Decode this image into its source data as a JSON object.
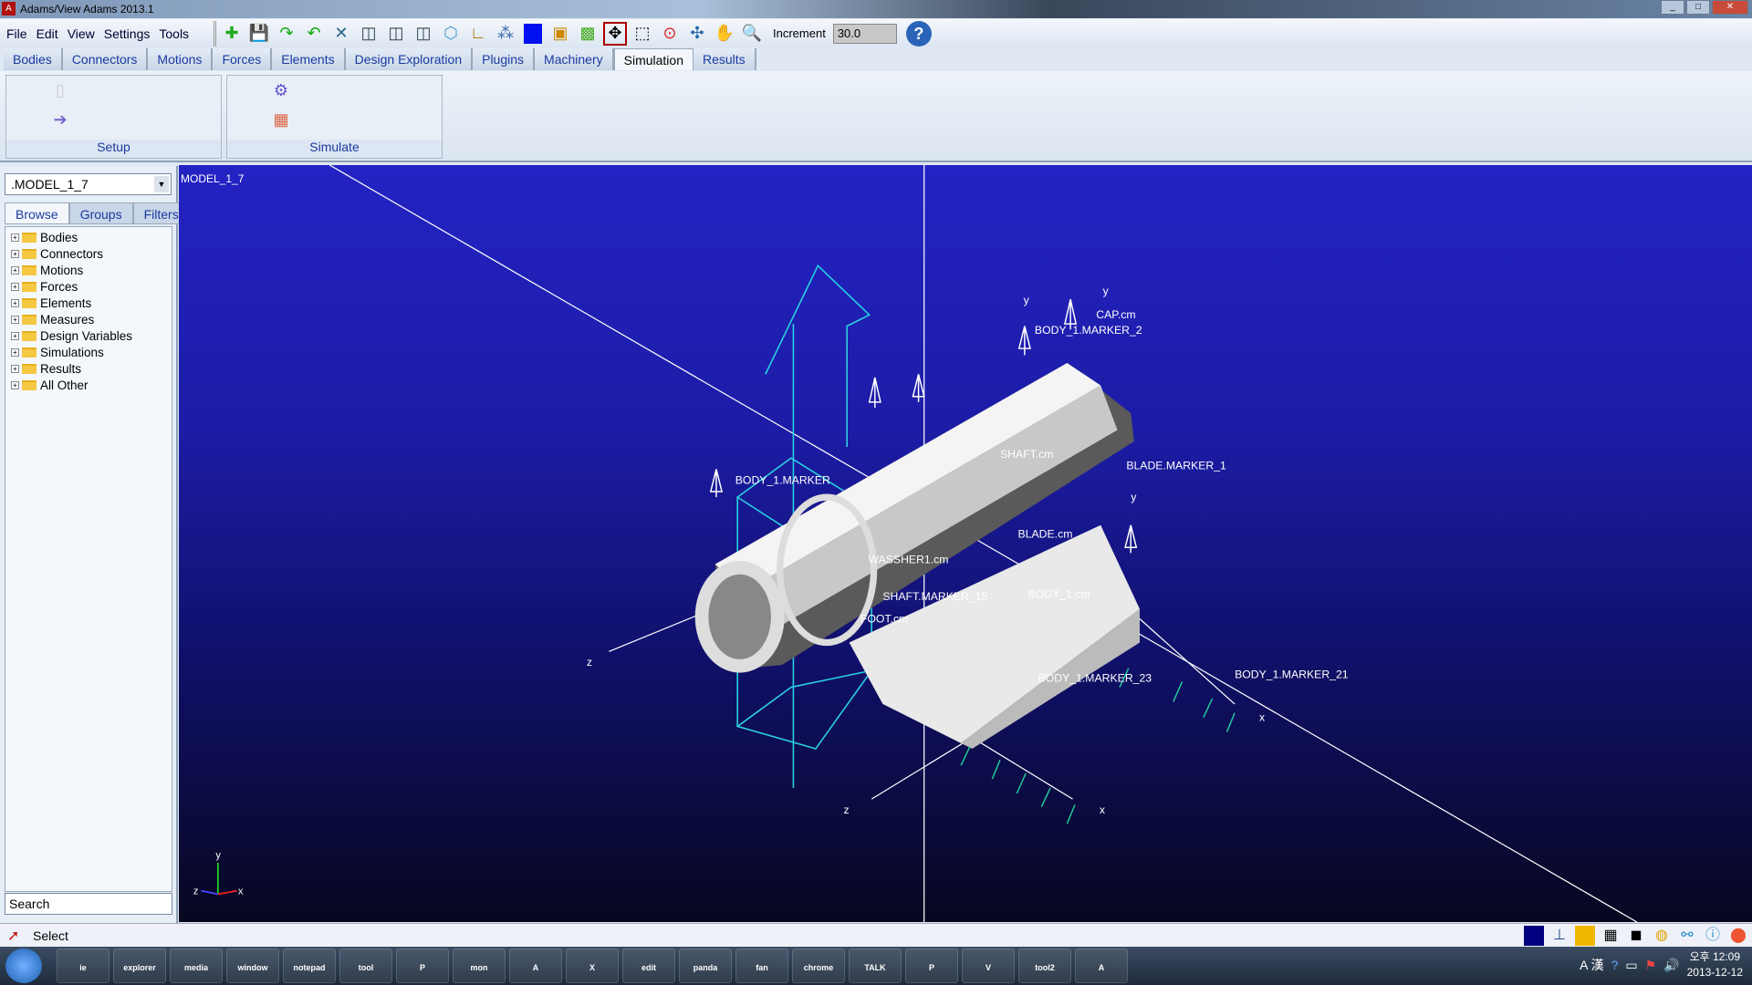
{
  "window": {
    "title": "Adams/View Adams 2013.1",
    "app_icon": "A"
  },
  "menu": [
    "File",
    "Edit",
    "View",
    "Settings",
    "Tools"
  ],
  "toolbar": {
    "icons": [
      "new-model-icon",
      "save-icon",
      "redo-icon",
      "undo-icon",
      "select-tools-icon",
      "front-view-icon",
      "side-view-icon",
      "top-view-icon",
      "iso-view-icon",
      "coordinate-icon",
      "render-options-icon",
      "color-icon",
      "dialog-icon",
      "group-icon",
      "fit-icon",
      "zoom-box-icon",
      "target-icon",
      "rotate-icon",
      "pan-icon",
      "zoom-icon"
    ],
    "increment_label": "Increment",
    "increment_value": "30.0",
    "help": "?"
  },
  "tabs": [
    "Bodies",
    "Connectors",
    "Motions",
    "Forces",
    "Elements",
    "Design Exploration",
    "Plugins",
    "Machinery",
    "Simulation",
    "Results"
  ],
  "active_tab": "Simulation",
  "ribbon": {
    "panels": [
      {
        "label": "Setup"
      },
      {
        "label": "Simulate"
      }
    ]
  },
  "browser": {
    "model": ".MODEL_1_7",
    "tabs": [
      "Browse",
      "Groups",
      "Filters"
    ],
    "tree": [
      "Bodies",
      "Connectors",
      "Motions",
      "Forces",
      "Elements",
      "Measures",
      "Design Variables",
      "Simulations",
      "Results",
      "All Other"
    ],
    "search_placeholder": "Search"
  },
  "viewport": {
    "model_label": "MODEL_1_7",
    "labels": [
      "CAP.cm",
      "BODY_1.MARKER_2",
      "SHAFT.cm",
      "BLADE.MARKER_1",
      "BLADE.cm",
      "WASSHER1.cm",
      "SHAFT.MARKER_15",
      "BODY_1.cm",
      "FOOT.cm",
      "BODY_1.MARKER_23",
      "BODY_1.MARKER_21",
      "BODY_1.MARKER"
    ],
    "axes": {
      "x": "x",
      "y": "y",
      "z": "z"
    }
  },
  "status": {
    "text": "Select"
  },
  "taskbar": {
    "apps": [
      "ie",
      "explorer",
      "media",
      "window",
      "notepad",
      "tool",
      "P",
      "mon",
      "A",
      "X",
      "edit",
      "panda",
      "fan",
      "chrome",
      "TALK",
      "P",
      "V",
      "tool2",
      "A"
    ],
    "clock_time": "오후 12:09",
    "clock_date": "2013-12-12",
    "ime": "A 漢"
  }
}
